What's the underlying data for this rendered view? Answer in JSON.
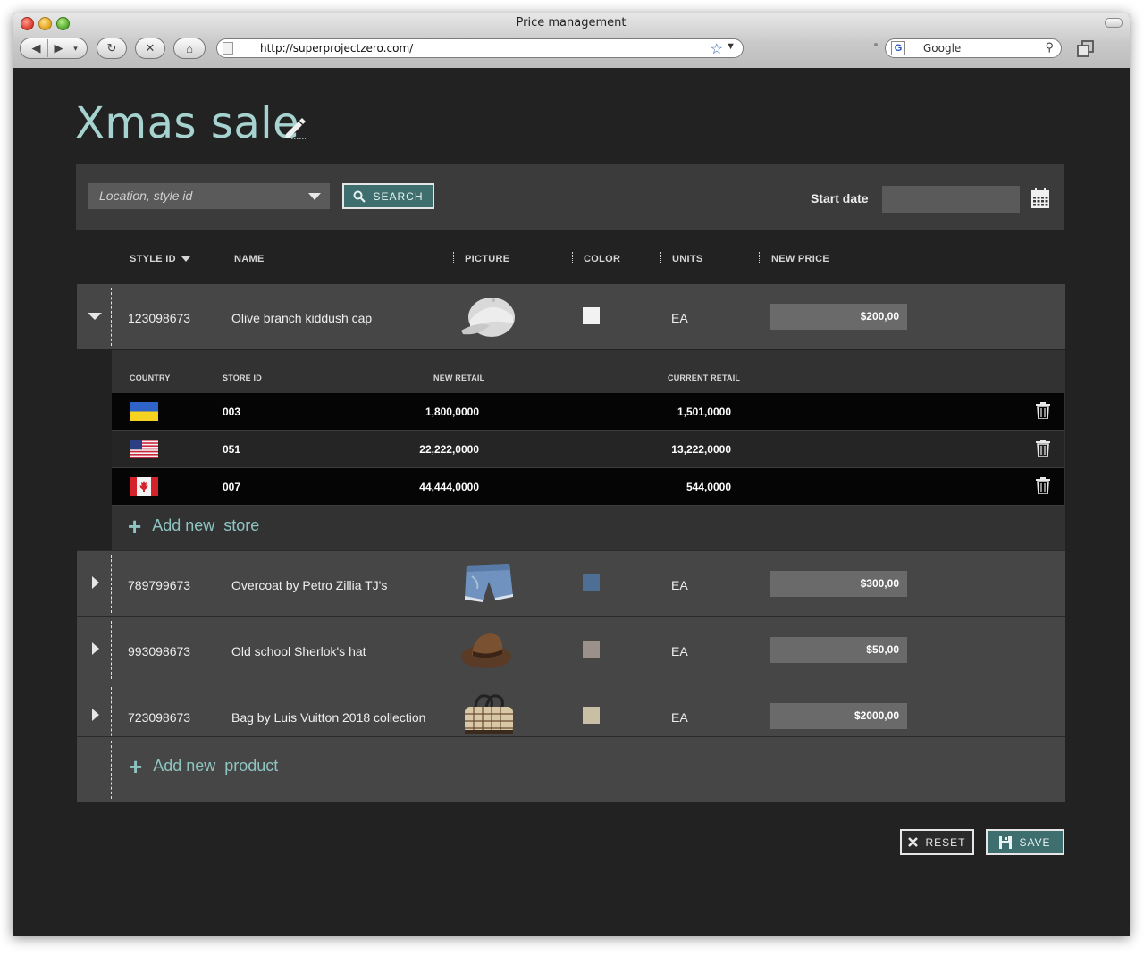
{
  "browser": {
    "window_title": "Price management",
    "url": "http://superprojectzero.com/",
    "search_engine_text": "Google"
  },
  "page": {
    "title": "Xmas sale"
  },
  "filter": {
    "location_placeholder": "Location, style id",
    "search_label": "SEARCH",
    "start_date_label": "Start date",
    "start_date_value": ""
  },
  "table": {
    "columns": [
      "STYLE ID",
      "NAME",
      "PICTURE",
      "COLOR",
      "UNITS",
      "NEW PRICE"
    ],
    "products": [
      {
        "style_id": "123098673",
        "name": "Olive branch kiddush cap",
        "picture": "white-cap",
        "color": "#f2f2f2",
        "units": "EA",
        "new_price": "$200,00",
        "expanded": true
      },
      {
        "style_id": "789799673",
        "name": "Overcoat by Petro Zillia TJ's",
        "picture": "denim-shorts",
        "color": "#4d6f94",
        "units": "EA",
        "new_price": "$300,00",
        "expanded": false
      },
      {
        "style_id": "993098673",
        "name": "Old school Sherlok's hat",
        "picture": "brown-fedora",
        "color": "#9c918a",
        "units": "EA",
        "new_price": "$50,00",
        "expanded": false
      },
      {
        "style_id": "723098673",
        "name": "Bag by Luis Vuitton 2018 collection",
        "picture": "plaid-bag",
        "color": "#c9bfa5",
        "units": "EA",
        "new_price": "$2000,00",
        "expanded": false
      }
    ],
    "add_product_label": "Add new  product"
  },
  "stores": {
    "columns": [
      "COUNTRY",
      "STORE ID",
      "NEW RETAIL",
      "CURRENT RETAIL"
    ],
    "rows": [
      {
        "country": "ukraine-flag",
        "store_id": "003",
        "new_retail": "1,800,0000",
        "current_retail": "1,501,0000"
      },
      {
        "country": "usa-flag",
        "store_id": "051",
        "new_retail": "22,222,0000",
        "current_retail": "13,222,0000"
      },
      {
        "country": "canada-flag",
        "store_id": "007",
        "new_retail": "44,444,0000",
        "current_retail": "544,0000"
      }
    ],
    "add_store_label": "Add new  store"
  },
  "actions": {
    "reset_label": "RESET",
    "save_label": "SAVE"
  },
  "colors": {
    "accent": "#8ec4c0",
    "button_teal": "#3e6e6e",
    "background": "#222223"
  }
}
